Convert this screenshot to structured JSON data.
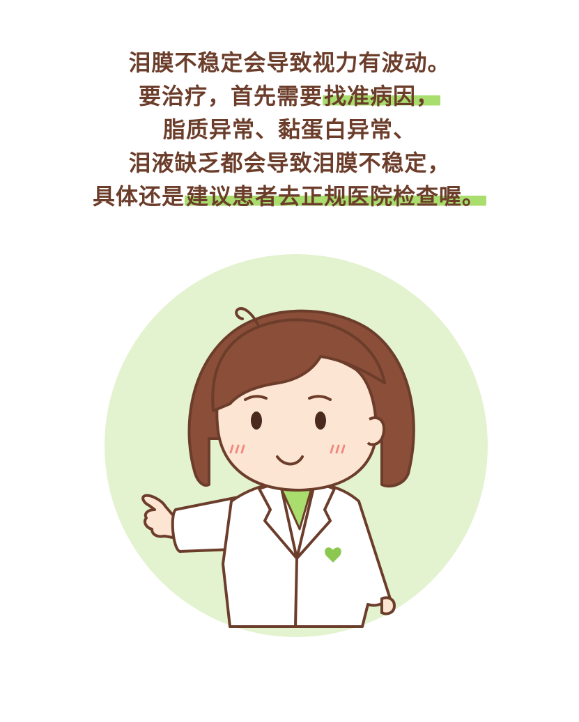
{
  "text": {
    "line1": "泪膜不稳定会导致视力有波动。",
    "line2_pre": "要治疗，首先需要",
    "line2_hl": "找准病因，",
    "line3": "脂质异常、黏蛋白异常、",
    "line4": "泪液缺乏都会导致泪膜不稳定，",
    "line5_pre": "具体还是",
    "line5_hl": "建议患者去正规医院检查喔。"
  },
  "colors": {
    "text": "#6b3d2a",
    "highlight": "#a9dd6e",
    "circle_bg": "#e3f2cf",
    "hair": "#8a4e39",
    "skin": "#fde5d4",
    "coat": "#ffffff",
    "shirt": "#a9dd6e"
  },
  "illustration": {
    "subject": "doctor-character",
    "icons": [
      "green-heart-icon"
    ]
  }
}
